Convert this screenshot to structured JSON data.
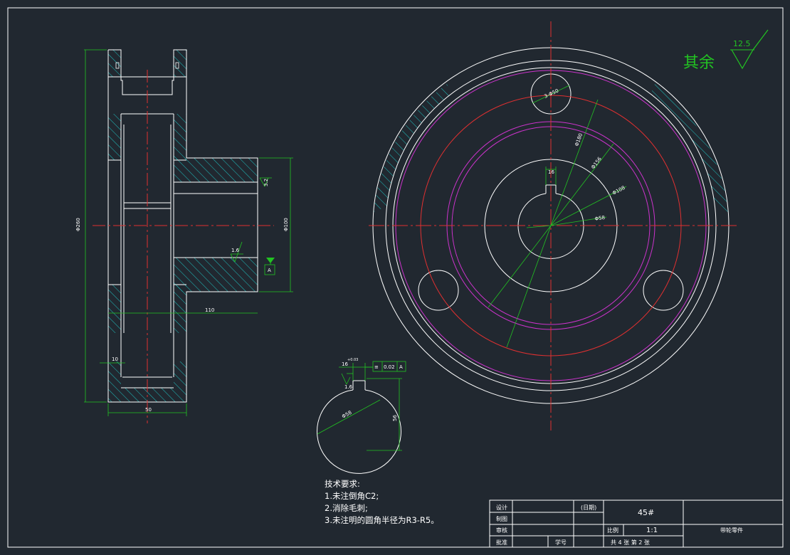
{
  "surface_finish": {
    "text": "其余",
    "value": "12.5"
  },
  "side_view": {
    "dim_overall_dia": "Φ260",
    "dim_hub_dia": "Φ100",
    "dim_length": "110",
    "dim_rim_width": "50",
    "dim_small": "10",
    "roughness_bore": "3.2",
    "roughness_face": "1.6",
    "datum": "A"
  },
  "front_view": {
    "dim_holes": "3-Φ50",
    "dim_pitch": "Φ180",
    "dim_a": "Φ156",
    "dim_b": "Φ108",
    "dim_bore": "Φ58",
    "dim_key": "16"
  },
  "keyway_detail": {
    "dim_key": "16",
    "dim_keytol": "+0.03",
    "tolerance_symbol": "≡",
    "tolerance_value": "0.02",
    "tolerance_datum": "A",
    "roughness": "1.6",
    "dim_bore": "Φ58",
    "dim_depth": "56"
  },
  "tech_requirements": {
    "title": "技术要求:",
    "items": [
      "1.未注倒角C2;",
      "2.消除毛刺;",
      "3.未注明的圆角半径为R3-R5。"
    ]
  },
  "title_block": {
    "r1_label": "设计",
    "r2_label": "制图",
    "r3_label": "审核",
    "r4_label": "批准",
    "date_label": "(日期)",
    "material": "45#",
    "scale_label": "比例",
    "scale_value": "1:1",
    "sheet_info": "共 4 张  第 2 张",
    "part_name": "带轮零件",
    "r4_mid": "学号"
  }
}
